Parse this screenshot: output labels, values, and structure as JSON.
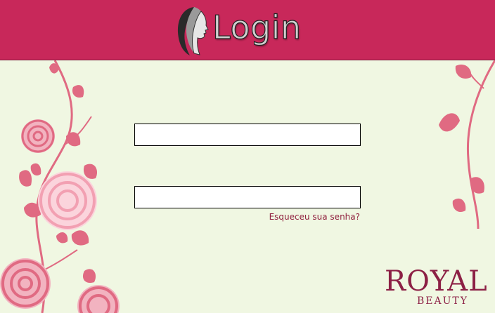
{
  "header": {
    "title": "Login",
    "icon": "woman-silhouette-icon"
  },
  "form": {
    "username_value": "",
    "password_value": "",
    "forgot_password_label": "Esqueceu sua senha?"
  },
  "brand": {
    "name": "ROYAL",
    "tagline": "BEAUTY"
  },
  "colors": {
    "header_bg": "#c8285a",
    "page_bg": "#f0f7e2",
    "rose_primary": "#e06a82",
    "rose_light": "#f3b3bf",
    "link": "#8f1f3d",
    "brand": "#8c2045"
  }
}
